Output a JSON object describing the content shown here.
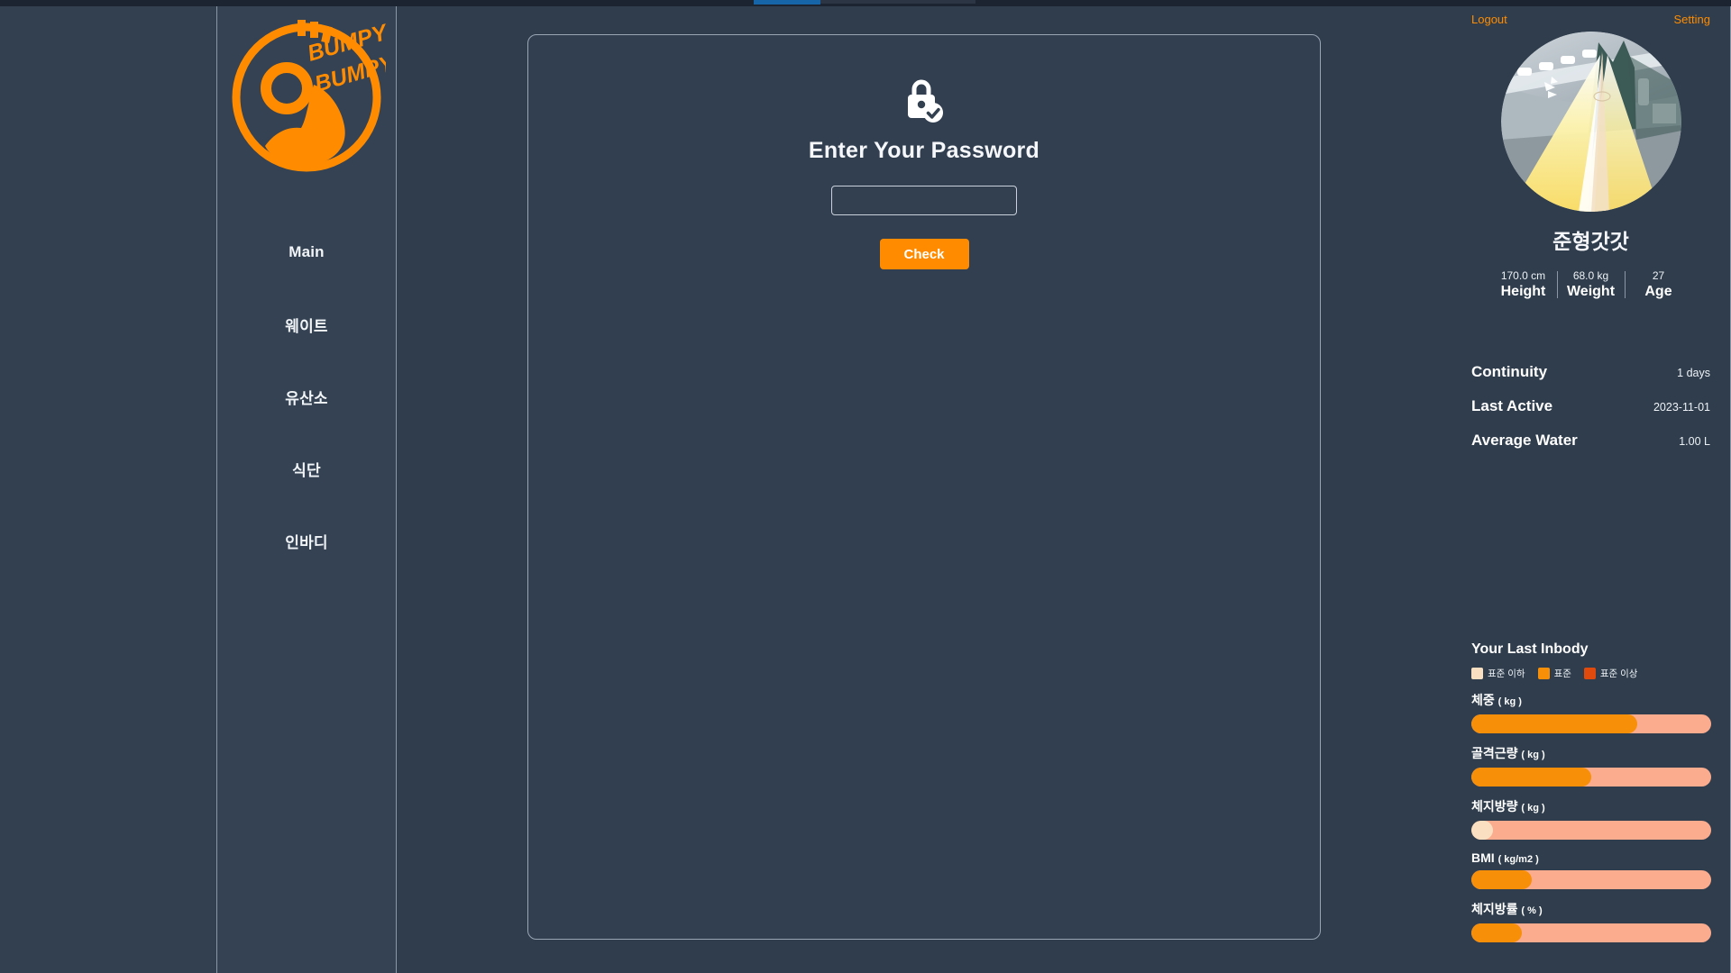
{
  "colors": {
    "accent": "#ff8c00",
    "panel_bg": "#2f3d4d",
    "sidebar_bg": "#344253",
    "card_bg": "#323f50",
    "bar_track": "#fbab8e",
    "below_standard": "#fae0c0",
    "standard": "#f78f08",
    "above_standard": "#e04a0c"
  },
  "topbar": {
    "progress_label": "page-load-progress"
  },
  "sidebar": {
    "logo_text_line1": "BUMPY",
    "logo_text_line2": "BUMPY",
    "logo_alt": "bumpy-bumpy-logo",
    "items": [
      {
        "label": "Main",
        "name": "sidebar-item-main"
      },
      {
        "label": "웨이트",
        "name": "sidebar-item-weight"
      },
      {
        "label": "유산소",
        "name": "sidebar-item-cardio"
      },
      {
        "label": "식단",
        "name": "sidebar-item-diet"
      },
      {
        "label": "인바디",
        "name": "sidebar-item-inbody"
      }
    ]
  },
  "main": {
    "icon": "lock-check-icon",
    "title": "Enter Your Password",
    "password_value": "",
    "password_placeholder": "",
    "check_label": "Check"
  },
  "rightpanel": {
    "logout_label": "Logout",
    "setting_label": "Setting",
    "avatar_alt": "user-avatar",
    "user_name": "준형갓갓",
    "stats": [
      {
        "value": "170.0 cm",
        "label": "Height"
      },
      {
        "value": "68.0 kg",
        "label": "Weight"
      },
      {
        "value": "27",
        "label": "Age"
      }
    ],
    "kv": [
      {
        "key": "Continuity",
        "value": "1 days"
      },
      {
        "key": "Last Active",
        "value": "2023-11-01"
      },
      {
        "key": "Average Water",
        "value": "1.00 L"
      }
    ],
    "inbody": {
      "title": "Your Last Inbody",
      "legend": [
        {
          "label": "표준 이하",
          "color": "#fae0c0"
        },
        {
          "label": "표준",
          "color": "#f78f08"
        },
        {
          "label": "표준 이상",
          "color": "#e04a0c"
        }
      ],
      "metrics": [
        {
          "name": "체중",
          "unit": "( kg )",
          "percent": 69,
          "color": "#f78f08"
        },
        {
          "name": "골격근량",
          "unit": "( kg )",
          "percent": 50,
          "color": "#f78f08"
        },
        {
          "name": "체지방량",
          "unit": "( kg )",
          "percent": 9,
          "color": "#fae0c0"
        },
        {
          "name": "BMI",
          "unit": "( kg/m2 )",
          "percent": 25,
          "color": "#f78f08"
        },
        {
          "name": "체지방률",
          "unit": "( % )",
          "percent": 21,
          "color": "#f78f08"
        }
      ]
    }
  }
}
